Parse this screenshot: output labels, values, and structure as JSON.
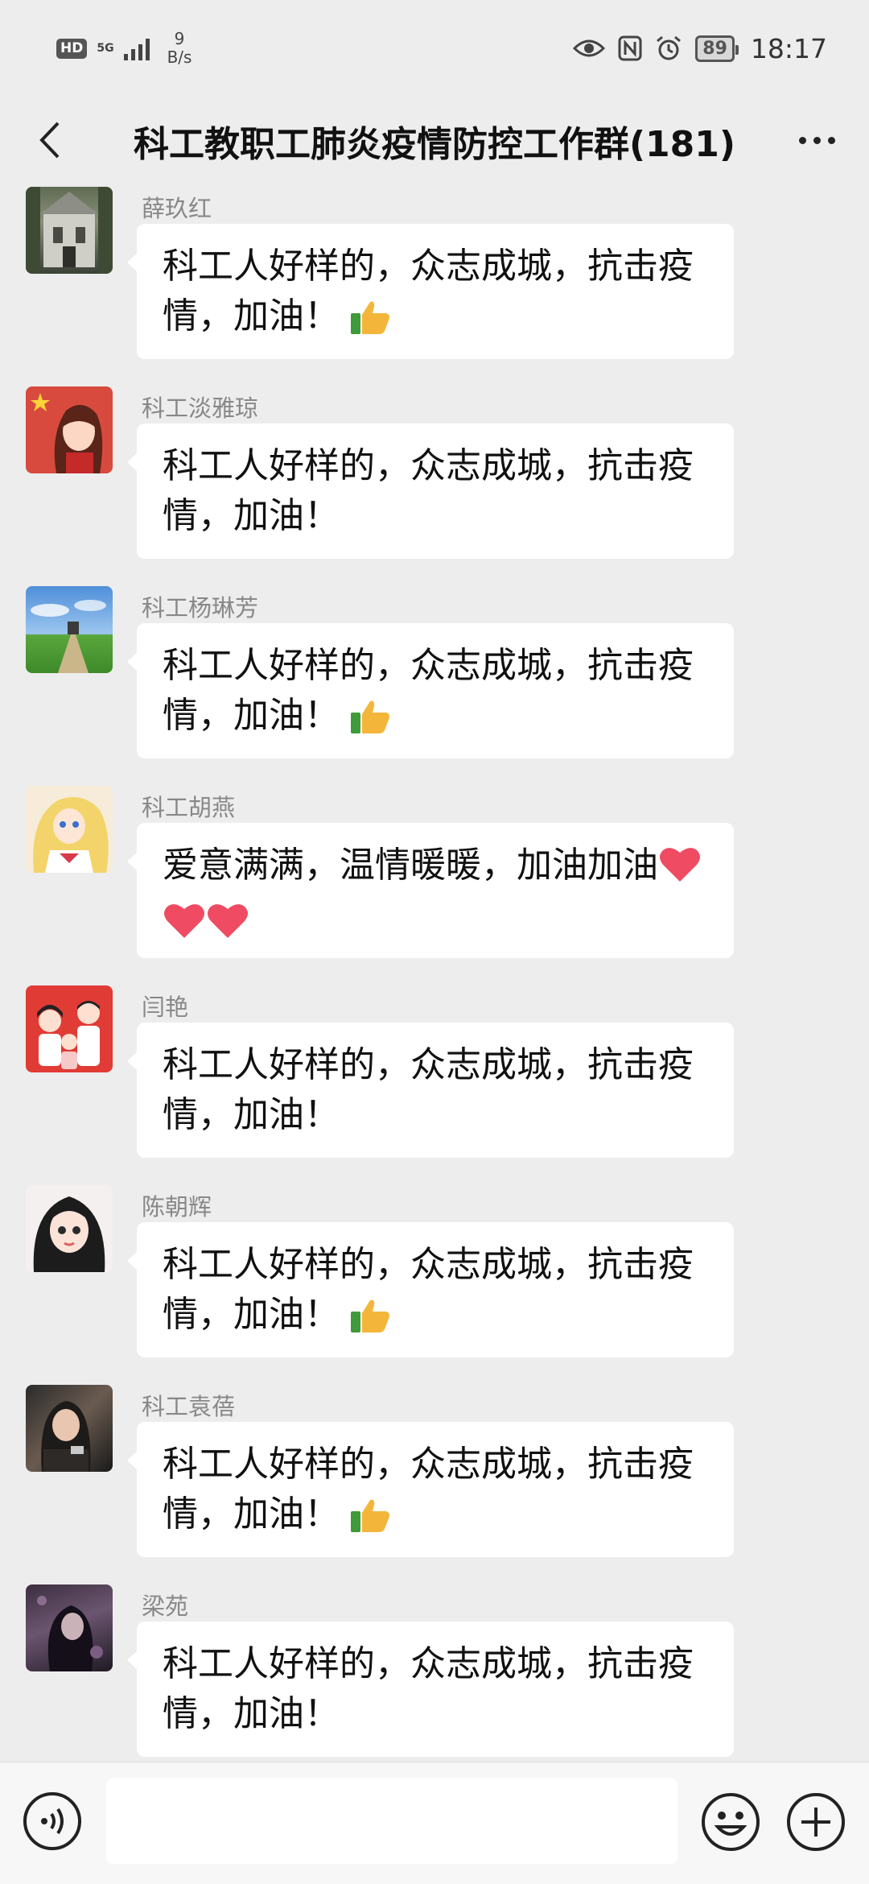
{
  "status_bar": {
    "hd": "HD",
    "network": "5G",
    "speed_value": "9",
    "speed_unit": "B/s",
    "battery": "89",
    "time": "18:17",
    "icons": [
      "eye-icon",
      "nfc-icon",
      "alarm-icon"
    ]
  },
  "header": {
    "title": "科工教职工肺炎疫情防控工作群(181)",
    "back_icon": "back-chevron-icon",
    "more_icon": "more-dots-icon"
  },
  "messages": [
    {
      "sender": "薛玖红",
      "text": "科工人好样的，众志成城，抗击疫情，加油！",
      "emoji": "thumbs-up-icon"
    },
    {
      "sender": "科工淡雅琼",
      "text": "科工人好样的，众志成城，抗击疫情，加油！",
      "emoji": ""
    },
    {
      "sender": "科工杨琳芳",
      "text": "科工人好样的，众志成城，抗击疫情，加油！",
      "emoji": "thumbs-up-icon"
    },
    {
      "sender": "科工胡燕",
      "text": "爱意满满，温情暖暖，加油加油",
      "emoji": "heart-icon"
    },
    {
      "sender": "闫艳",
      "text": "科工人好样的，众志成城，抗击疫情，加油！",
      "emoji": ""
    },
    {
      "sender": "陈朝辉",
      "text": "科工人好样的，众志成城，抗击疫情，加油！",
      "emoji": "thumbs-up-icon"
    },
    {
      "sender": "科工袁蓓",
      "text": "科工人好样的，众志成城，抗击疫情，加油！",
      "emoji": "thumbs-up-icon"
    },
    {
      "sender": "梁苑",
      "text": "科工人好样的，众志成城，抗击疫情，加油！",
      "emoji": ""
    }
  ],
  "input_bar": {
    "message_value": "",
    "icons": [
      "voice-icon",
      "emoji-icon",
      "plus-icon"
    ]
  },
  "colors": {
    "background": "#ededed",
    "bubble": "#ffffff",
    "sender_text": "#888888"
  }
}
